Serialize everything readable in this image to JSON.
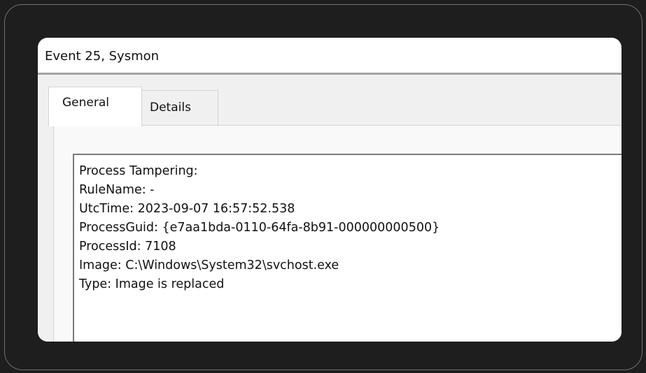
{
  "window": {
    "title": "Event 25, Sysmon"
  },
  "tabs": [
    {
      "label": "General",
      "selected": true
    },
    {
      "label": "Details",
      "selected": false
    }
  ],
  "general": {
    "lines": [
      "Process Tampering:",
      "RuleName: -",
      "UtcTime: 2023-09-07 16:57:52.538",
      "ProcessGuid: {e7aa1bda-0110-64fa-8b91-000000000500}",
      "ProcessId: 7108",
      "Image: C:\\Windows\\System32\\svchost.exe",
      "Type: Image is replaced"
    ]
  },
  "colors": {
    "background": "#1e1e1e",
    "window": "#ffffff",
    "panel": "#f0f0f0",
    "text": "#111111"
  }
}
